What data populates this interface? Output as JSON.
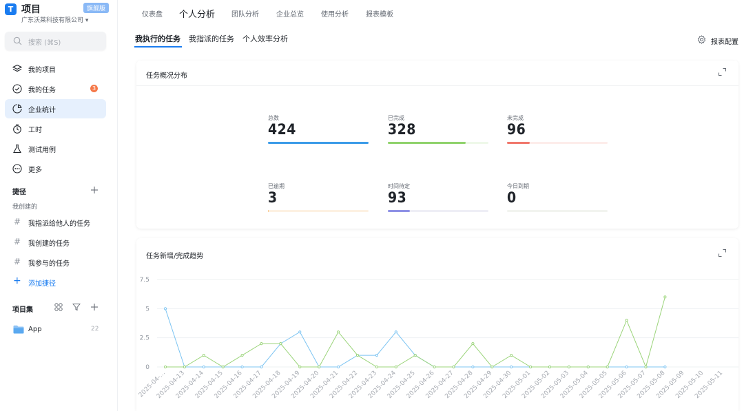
{
  "brand": {
    "title": "项目",
    "badge": "旗舰版",
    "org": "广东沃莱科技有限公司 ▾"
  },
  "search": {
    "placeholder": "搜索 (⌘S)"
  },
  "nav": [
    {
      "label": "我的项目",
      "icon": "layers-icon"
    },
    {
      "label": "我的任务",
      "icon": "check-circle-icon",
      "badge": "3"
    },
    {
      "label": "企业统计",
      "icon": "pie-chart-icon",
      "active": true
    },
    {
      "label": "工时",
      "icon": "timer-icon"
    },
    {
      "label": "测试用例",
      "icon": "flask-icon"
    },
    {
      "label": "更多",
      "icon": "more-circle-icon"
    }
  ],
  "shortcuts": {
    "title": "捷径",
    "subtitle": "我创建的",
    "items": [
      "我指派给他人的任务",
      "我创建的任务",
      "我参与的任务"
    ],
    "add_label": "添加捷径"
  },
  "projects": {
    "title": "项目集",
    "item": {
      "label": "App",
      "count": "22"
    }
  },
  "topnav": {
    "tabs": [
      "仪表盘",
      "个人分析",
      "团队分析",
      "企业总览",
      "使用分析",
      "报表模板"
    ],
    "active_index": 1
  },
  "subtabs": {
    "tabs": [
      "我执行的任务",
      "我指派的任务",
      "个人效率分析"
    ],
    "active_index": 0
  },
  "report_config": "报表配置",
  "overview": {
    "title": "任务概况分布",
    "stats": [
      {
        "label": "总数",
        "value": "424",
        "fraction": 1.0,
        "color": "#3b9be8",
        "track": "#e3f0fb"
      },
      {
        "label": "已完成",
        "value": "328",
        "fraction": 0.773,
        "color": "#8fd26b",
        "track": "#eef8e9"
      },
      {
        "label": "未完成",
        "value": "96",
        "fraction": 0.226,
        "color": "#f0776b",
        "track": "#fdecea"
      },
      {
        "label": "已逾期",
        "value": "3",
        "fraction": 0.007,
        "color": "#f9c98f",
        "track": "#fdf1e2"
      },
      {
        "label": "时间待定",
        "value": "93",
        "fraction": 0.219,
        "color": "#8f92e6",
        "track": "#eeeef6"
      },
      {
        "label": "今日到期",
        "value": "0",
        "fraction": 0.0,
        "color": "#cfd8c4",
        "track": "#f2f4ef"
      }
    ]
  },
  "trend": {
    "title": "任务新增/完成趋势"
  },
  "chart_data": {
    "type": "line",
    "x": [
      "2025-04-…",
      "2025-04-13",
      "2025-04-14",
      "2025-04-15",
      "2025-04-16",
      "2025-04-17",
      "2025-04-18",
      "2025-04-19",
      "2025-04-20",
      "2025-04-21",
      "2025-04-22",
      "2025-04-23",
      "2025-04-24",
      "2025-04-25",
      "2025-04-26",
      "2025-04-27",
      "2025-04-28",
      "2025-04-29",
      "2025-04-30",
      "2025-05-01",
      "2025-05-02",
      "2025-05-03",
      "2025-05-04",
      "2025-05-05",
      "2025-05-06",
      "2025-05-07",
      "2025-05-08",
      "2025-05-09",
      "2025-05-10",
      "2025-05-11"
    ],
    "series": [
      {
        "color": "#7cc4f2",
        "values": [
          5,
          0,
          0,
          0,
          0,
          0,
          2,
          3,
          0,
          0,
          1,
          1,
          3,
          1,
          0,
          0,
          0,
          0,
          0,
          0,
          0,
          0,
          0,
          0,
          0,
          0,
          0,
          null,
          null,
          null
        ]
      },
      {
        "color": "#9bd47a",
        "values": [
          0,
          0,
          1,
          0,
          1,
          2,
          2,
          0,
          0,
          3,
          1,
          0,
          0,
          1,
          0,
          0,
          2,
          0,
          1,
          0,
          0,
          0,
          0,
          0,
          4,
          0,
          6,
          null,
          null,
          null
        ]
      }
    ],
    "yticks": [
      "0",
      "2.5",
      "5",
      "7.5"
    ],
    "ylim": [
      0,
      7.5
    ],
    "grid": true
  }
}
